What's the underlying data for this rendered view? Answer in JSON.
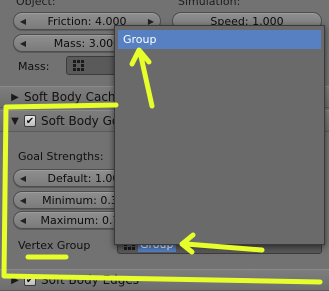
{
  "top_section": {
    "object_label": "Object:",
    "simulation_label": "Simulation:",
    "friction_field": "Friction: 4.000",
    "speed_field": "Speed: 1.000",
    "mass_field": "Mass: 3.000",
    "mass_row_label": "Mass:"
  },
  "panels": {
    "cache_title": "Soft Body Cache",
    "goal_title": "Soft Body Goal",
    "edges_title": "Soft Body Edges"
  },
  "goal": {
    "strengths_label": "Goal Strengths:",
    "default_field": "Default: 1.000",
    "minimum_field": "Minimum: 0.300",
    "maximum_field": "Maximum: 0.700",
    "vertex_group_label": "Vertex Group",
    "vertex_group_value": "Group"
  },
  "popup": {
    "items": [
      "Group"
    ]
  },
  "annotation": {
    "color": "#e6ff2a"
  },
  "colors": {
    "highlight": "#5680c2",
    "background": "#727272"
  }
}
